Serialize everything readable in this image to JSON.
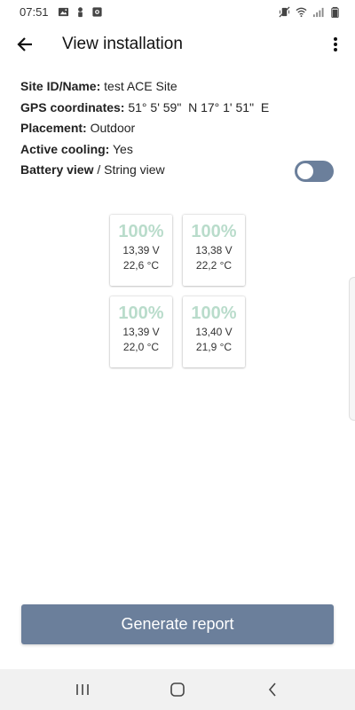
{
  "status_bar": {
    "time": "07:51",
    "left_icons": [
      "image-icon",
      "person-icon",
      "record-icon"
    ],
    "right_icons": [
      "mute-vibrate-icon",
      "wifi-icon",
      "signal-icon",
      "battery-icon"
    ]
  },
  "app_bar": {
    "title": "View installation",
    "back_icon": "arrow-back-icon",
    "menu_icon": "more-vertical-icon"
  },
  "info": {
    "site_label": "Site ID/Name:",
    "site_value": "test ACE Site",
    "gps_label": "GPS coordinates:",
    "gps_value": "51° 5' 59\"  N 17° 1' 51\"  E",
    "placement_label": "Placement:",
    "placement_value": "Outdoor",
    "cooling_label": "Active cooling:",
    "cooling_value": "Yes",
    "view_label_active": "Battery view",
    "view_separator": " / ",
    "view_label_inactive": "String view",
    "view_toggle_on": true
  },
  "batteries": [
    {
      "percent": "100%",
      "voltage": "13,39 V",
      "temperature": "22,6 °C"
    },
    {
      "percent": "100%",
      "voltage": "13,38 V",
      "temperature": "22,2 °C"
    },
    {
      "percent": "100%",
      "voltage": "13,39 V",
      "temperature": "22,0 °C"
    },
    {
      "percent": "100%",
      "voltage": "13,40 V",
      "temperature": "21,9 °C"
    }
  ],
  "actions": {
    "generate_label": "Generate report"
  },
  "nav_bar": {
    "recents_icon": "recents-icon",
    "home_icon": "home-icon",
    "back_icon": "back-chevron-icon"
  },
  "colors": {
    "accent": "#6b7f9b",
    "battery_percent": "#b9dccb",
    "nav_background": "#f1f1f1"
  }
}
